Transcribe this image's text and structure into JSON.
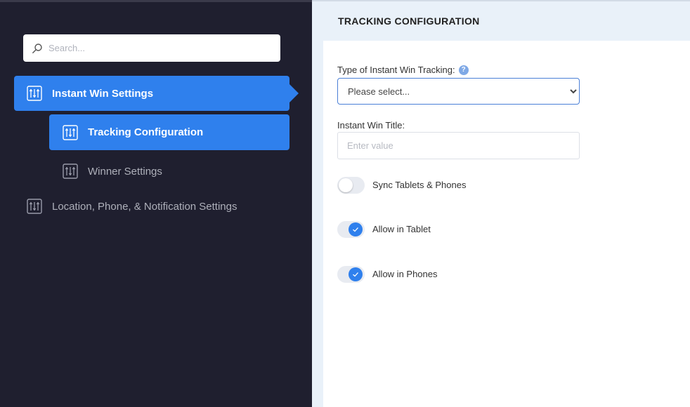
{
  "sidebar": {
    "search": {
      "placeholder": "Search..."
    },
    "items": [
      {
        "label": "Instant Win Settings",
        "active": true
      },
      {
        "label": "Tracking Configuration",
        "active": true
      },
      {
        "label": "Winner Settings",
        "active": false
      },
      {
        "label": "Location, Phone, & Notification Settings",
        "active": false
      }
    ]
  },
  "main": {
    "header_title": "TRACKING CONFIGURATION",
    "tracking_type": {
      "label": "Type of Instant Win Tracking:",
      "help_icon": "?",
      "selected": "Please select..."
    },
    "title_field": {
      "label": "Instant Win Title:",
      "placeholder": "Enter value"
    },
    "toggles": [
      {
        "label": "Sync Tablets & Phones",
        "on": false
      },
      {
        "label": "Allow in Tablet",
        "on": true
      },
      {
        "label": "Allow in Phones",
        "on": true
      }
    ]
  },
  "colors": {
    "sidebar_bg": "#1f1f2f",
    "accent": "#2f80ed",
    "main_bg": "#e9f1f9"
  }
}
